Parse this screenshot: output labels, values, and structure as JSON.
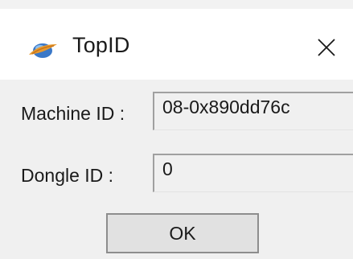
{
  "window": {
    "title": "TopID",
    "close_icon": "close-icon",
    "app_icon": "topid-app-icon"
  },
  "form": {
    "machine_id_label": "Machine ID :",
    "machine_id_value": "08-0x890dd76c",
    "dongle_id_label": "Dongle ID :",
    "dongle_id_value": "0"
  },
  "buttons": {
    "ok_label": "OK"
  },
  "colors": {
    "dialog_background": "#f0f0f0",
    "titlebar_background": "#ffffff",
    "field_border": "#a0a0a0",
    "button_face": "#e1e1e1"
  }
}
